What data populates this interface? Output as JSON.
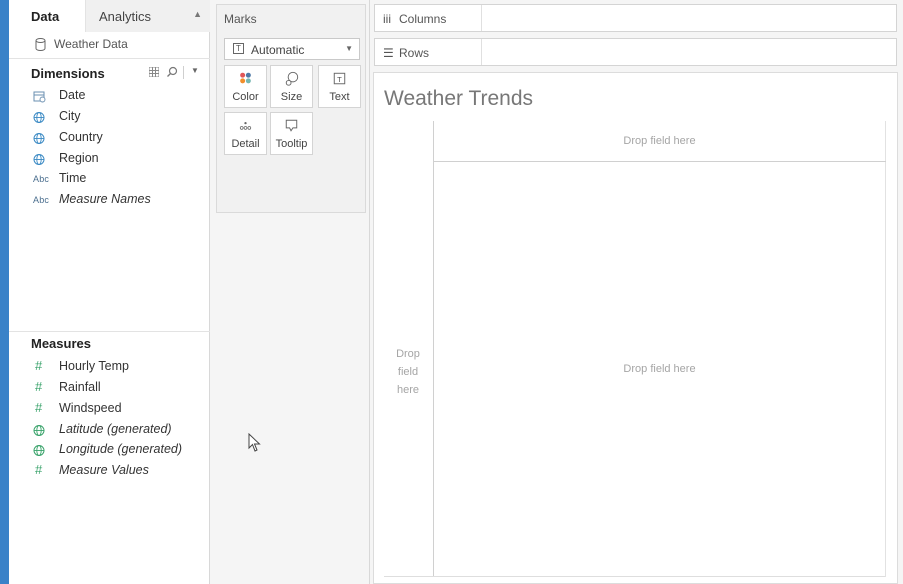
{
  "data_pane": {
    "tabs": [
      {
        "label": "Data"
      },
      {
        "label": "Analytics"
      }
    ],
    "datasource": {
      "name": "Weather Data",
      "icon": "database-icon"
    },
    "dimensions": {
      "title": "Dimensions",
      "items": [
        {
          "label": "Date",
          "icon": "calendar-icon",
          "italic": false
        },
        {
          "label": "City",
          "icon": "globe-icon",
          "italic": false
        },
        {
          "label": "Country",
          "icon": "globe-icon",
          "italic": false
        },
        {
          "label": "Region",
          "icon": "globe-icon",
          "italic": false
        },
        {
          "label": "Time",
          "icon": "abc-icon",
          "icon_text": "Abc",
          "italic": false
        },
        {
          "label": "Measure Names",
          "icon": "abc-icon",
          "icon_text": "Abc",
          "italic": true
        }
      ]
    },
    "measures": {
      "title": "Measures",
      "items": [
        {
          "label": "Hourly Temp",
          "icon": "hash-icon",
          "italic": false
        },
        {
          "label": "Rainfall",
          "icon": "hash-icon",
          "italic": false
        },
        {
          "label": "Windspeed",
          "icon": "hash-icon",
          "italic": false
        },
        {
          "label": "Latitude (generated)",
          "icon": "globe-icon",
          "italic": true
        },
        {
          "label": "Longitude (generated)",
          "icon": "globe-icon",
          "italic": true
        },
        {
          "label": "Measure Values",
          "icon": "hash-icon",
          "italic": true
        }
      ]
    }
  },
  "marks": {
    "title": "Marks",
    "mark_type": "Automatic",
    "buttons": [
      {
        "label": "Color",
        "icon": "color-icon"
      },
      {
        "label": "Size",
        "icon": "size-icon"
      },
      {
        "label": "Text",
        "icon": "text-icon"
      },
      {
        "label": "Detail",
        "icon": "detail-icon"
      },
      {
        "label": "Tooltip",
        "icon": "tooltip-icon"
      }
    ]
  },
  "shelves": {
    "columns": {
      "icon_text": "iii",
      "label": "Columns"
    },
    "rows": {
      "icon_text": "☰",
      "label": "Rows"
    }
  },
  "view": {
    "title": "Weather Trends",
    "drop_top": "Drop field here",
    "drop_left_lines": [
      "Drop",
      "field",
      "here"
    ],
    "drop_center": "Drop field here"
  },
  "colors": {
    "accent_blue": "#3a82c8",
    "measure_green": "#3aa36b",
    "dimension_blue": "#4a6e8e"
  }
}
